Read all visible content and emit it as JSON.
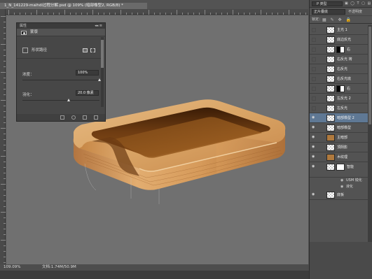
{
  "document": {
    "tab_title": "1_N_141229-maihdi过程分解.psd @ 109% (暗部橡型2, RGB/8) *",
    "close_glyph": "×"
  },
  "status_bar": {
    "zoom": "109.09%",
    "doc_size": "文档:1.74M/50.9M"
  },
  "properties_panel": {
    "title": "属性",
    "controls": "◂◂ ≡",
    "mask_label": "蒙版",
    "vector_mask_label": "形状路径",
    "density_label": "浓度：",
    "density_value": "100%",
    "density_fraction": 1.0,
    "feather_label": "羽化：",
    "feather_value": "20.0 像素",
    "feather_fraction": 0.6
  },
  "layers_panel": {
    "filter_label": "P 类型",
    "filter_icons": "▣ ◯ T ▢ ▤",
    "blend_mode": "正片叠底",
    "opacity_label": "不透明度",
    "lock_label": "锁定：",
    "lock_icons": "▦ ✎ ✥ 🔒",
    "layers": [
      {
        "name": "主光 1",
        "visible": false,
        "thumb": "checker",
        "mask": "none",
        "fx": false
      },
      {
        "name": "底边反光",
        "visible": false,
        "thumb": "checker",
        "mask": "none",
        "fx": false
      },
      {
        "name": "右",
        "visible": false,
        "thumb": "checker",
        "mask": "wb",
        "fx": false
      },
      {
        "name": "右反光 拷",
        "visible": false,
        "thumb": "checker",
        "mask": "none",
        "fx": false
      },
      {
        "name": "右反光",
        "visible": false,
        "thumb": "checker",
        "mask": "none",
        "fx": false
      },
      {
        "name": "右反光底",
        "visible": false,
        "thumb": "checker",
        "mask": "none",
        "fx": false
      },
      {
        "name": "右",
        "visible": false,
        "thumb": "checker",
        "mask": "wb",
        "fx": false
      },
      {
        "name": "左反光 2",
        "visible": false,
        "thumb": "checker",
        "mask": "none",
        "fx": false
      },
      {
        "name": "左反光",
        "visible": false,
        "thumb": "checker",
        "mask": "none",
        "fx": false
      },
      {
        "name": "暗部橡型 2",
        "visible": true,
        "thumb": "checker",
        "mask": "none",
        "fx": false,
        "selected": true
      },
      {
        "name": "暗部橡型",
        "visible": true,
        "thumb": "checker",
        "mask": "none",
        "fx": false
      },
      {
        "name": "主暗部",
        "visible": true,
        "thumb": "wood",
        "mask": "none",
        "fx": false
      },
      {
        "name": "顶阴影",
        "visible": true,
        "thumb": "checker",
        "mask": "none",
        "fx": false
      },
      {
        "name": "木纹理",
        "visible": true,
        "thumb": "wood",
        "mask": "none",
        "fx": false
      },
      {
        "name": "智能",
        "visible": true,
        "thumb": "checker",
        "mask": "white",
        "fx": false,
        "tall": true
      }
    ],
    "sub_items": [
      {
        "name": "USM 锐化",
        "eye": "◉"
      },
      {
        "name": "液化",
        "eye": "◉"
      }
    ],
    "bottom_layer": {
      "name": "底板",
      "visible": true
    }
  }
}
